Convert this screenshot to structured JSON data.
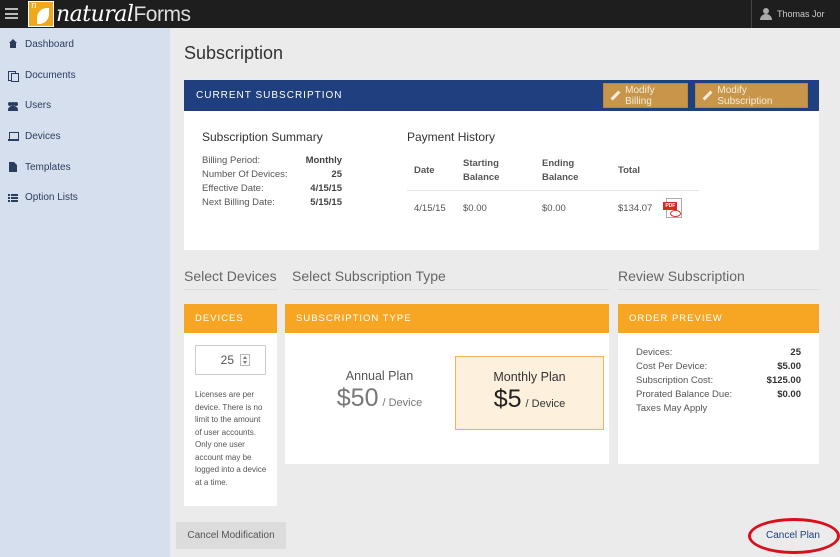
{
  "app": {
    "logo_prefix": "natural",
    "logo_suffix": "Forms",
    "logo_mark": "n",
    "user_name": "Thomas Jor"
  },
  "sidebar": {
    "items": [
      {
        "label": "Dashboard",
        "icon": "home-icon"
      },
      {
        "label": "Documents",
        "icon": "documents-icon"
      },
      {
        "label": "Users",
        "icon": "users-icon"
      },
      {
        "label": "Devices",
        "icon": "device-icon"
      },
      {
        "label": "Templates",
        "icon": "template-icon"
      },
      {
        "label": "Option Lists",
        "icon": "list-icon"
      }
    ]
  },
  "page": {
    "title": "Subscription"
  },
  "current_subscription": {
    "header": "CURRENT SUBSCRIPTION",
    "modify_billing_label": "Modify Billing",
    "modify_subscription_label": "Modify Subscription",
    "summary": {
      "title": "Subscription Summary",
      "rows": [
        {
          "label": "Billing Period:",
          "value": "Monthly"
        },
        {
          "label": "Number Of Devices:",
          "value": "25"
        },
        {
          "label": "Effective Date:",
          "value": "4/15/15"
        },
        {
          "label": "Next Billing Date:",
          "value": "5/15/15"
        }
      ]
    },
    "payment_history": {
      "title": "Payment History",
      "columns": [
        "Date",
        "Starting Balance",
        "Ending Balance",
        "Total"
      ],
      "rows": [
        {
          "date": "4/15/15",
          "starting": "$0.00",
          "ending": "$0.00",
          "total": "$134.07"
        }
      ]
    }
  },
  "sections": {
    "select_devices": "Select Devices",
    "select_type": "Select Subscription Type",
    "review": "Review Subscription"
  },
  "devices": {
    "header": "DEVICES",
    "count": "25",
    "note": "Licenses are per device. There is no limit to the amount of user accounts. Only one user account may be logged into a device at a time."
  },
  "subscription_type": {
    "header": "SUBSCRIPTION TYPE",
    "plans": [
      {
        "name": "Annual Plan",
        "price": "$50",
        "unit": "/ Device",
        "selected": false
      },
      {
        "name": "Monthly Plan",
        "price": "$5",
        "unit": "/ Device",
        "selected": true
      }
    ]
  },
  "order_preview": {
    "header": "ORDER PREVIEW",
    "rows": [
      {
        "label": "Devices:",
        "value": "25"
      },
      {
        "label": "Cost Per Device:",
        "value": "$5.00"
      },
      {
        "label": "Subscription Cost:",
        "value": "$125.00"
      },
      {
        "label": "Prorated Balance Due:",
        "value": "$0.00"
      },
      {
        "label": "Taxes May Apply",
        "value": ""
      }
    ]
  },
  "actions": {
    "cancel_modification": "Cancel Modification",
    "cancel_plan": "Cancel Plan"
  },
  "colors": {
    "navy": "#1f3f7e",
    "orange": "#f6a623",
    "sidebar": "#d6dfed",
    "highlight_red": "#d9101b"
  }
}
